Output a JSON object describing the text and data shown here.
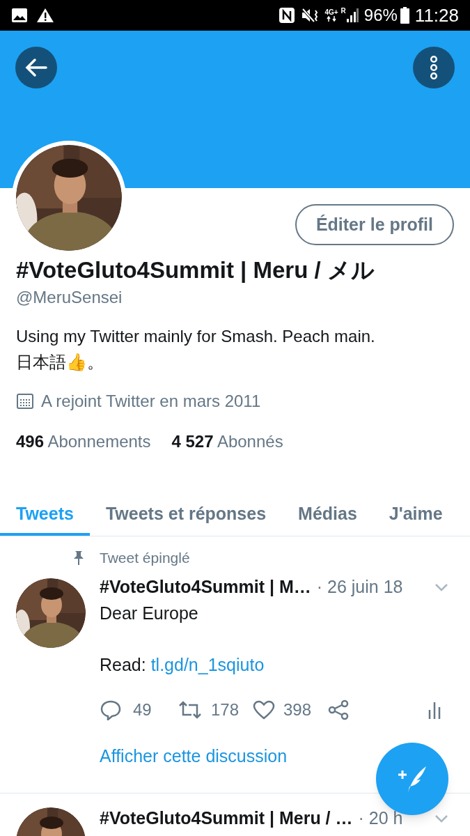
{
  "status_bar": {
    "network": "4G+",
    "roaming": "R",
    "battery": "96%",
    "time": "11:28"
  },
  "profile": {
    "edit_button": "Éditer le profil",
    "name": "#VoteGluto4Summit | Meru / メル",
    "handle": "@MeruSensei",
    "bio": "Using my Twitter mainly for Smash. Peach main.\n日本語👍。",
    "joined": "A rejoint Twitter en mars 2011",
    "stats": [
      {
        "count": "496",
        "label": "Abonnements"
      },
      {
        "count": "4 527",
        "label": "Abonnés"
      }
    ]
  },
  "tabs": [
    {
      "label": "Tweets",
      "selected": true
    },
    {
      "label": "Tweets et réponses",
      "selected": false
    },
    {
      "label": "Médias",
      "selected": false
    },
    {
      "label": "J'aime",
      "selected": false
    }
  ],
  "tweets": [
    {
      "pinned_label": "Tweet épinglé",
      "author": "#VoteGluto4Summit | M…",
      "time": "· 26 juin 18",
      "text": "Dear Europe",
      "link_prefix": "Read: ",
      "link": "tl.gd/n_1sqiuto",
      "replies": "49",
      "retweets": "178",
      "likes": "398",
      "thread_link": "Afficher cette discussion"
    },
    {
      "author": "#VoteGluto4Summit | Meru / …",
      "time": "· 20 h"
    }
  ]
}
